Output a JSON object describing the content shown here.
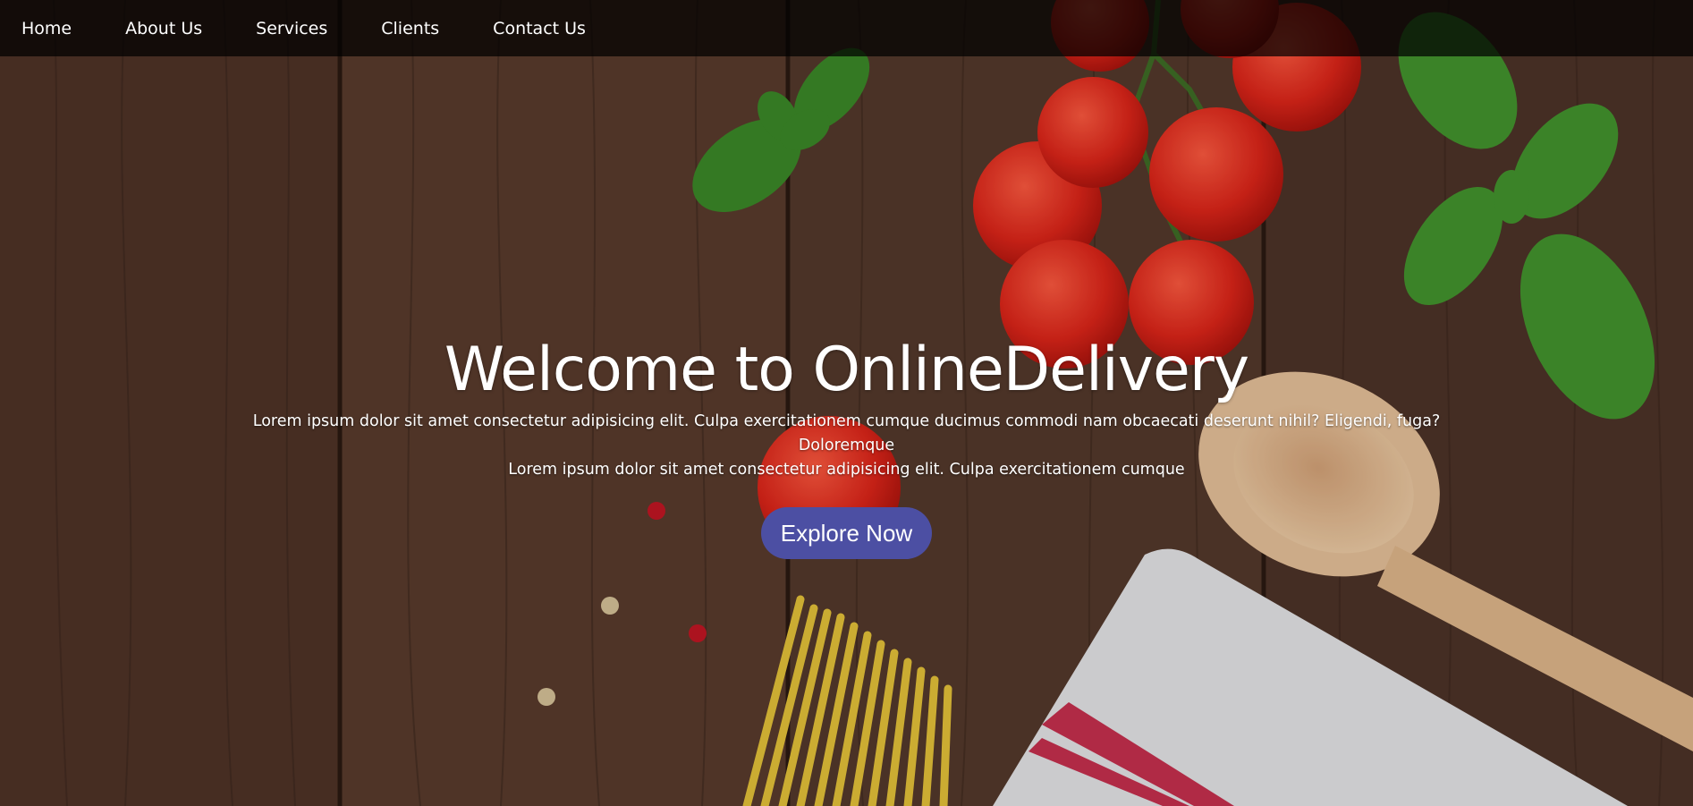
{
  "nav": {
    "items": [
      {
        "label": "Home"
      },
      {
        "label": "About Us"
      },
      {
        "label": "Services"
      },
      {
        "label": "Clients"
      },
      {
        "label": "Contact Us"
      }
    ]
  },
  "hero": {
    "title": "Welcome to OnlineDelivery",
    "description_line1": "Lorem ipsum dolor sit amet consectetur adipisicing elit. Culpa exercitationem cumque ducimus commodi nam obcaecati deserunt nihil? Eligendi, fuga? Doloremque",
    "description_line2": "Lorem ipsum dolor sit amet consectetur adipisicing elit. Culpa exercitationem cumque",
    "button_label": "Explore Now"
  },
  "colors": {
    "navbar_bg": "#000000",
    "button_bg": "#4c4fa3",
    "wood": "#5a3d2e",
    "tomato": "#e0261a",
    "basil": "#3f8a2a"
  }
}
